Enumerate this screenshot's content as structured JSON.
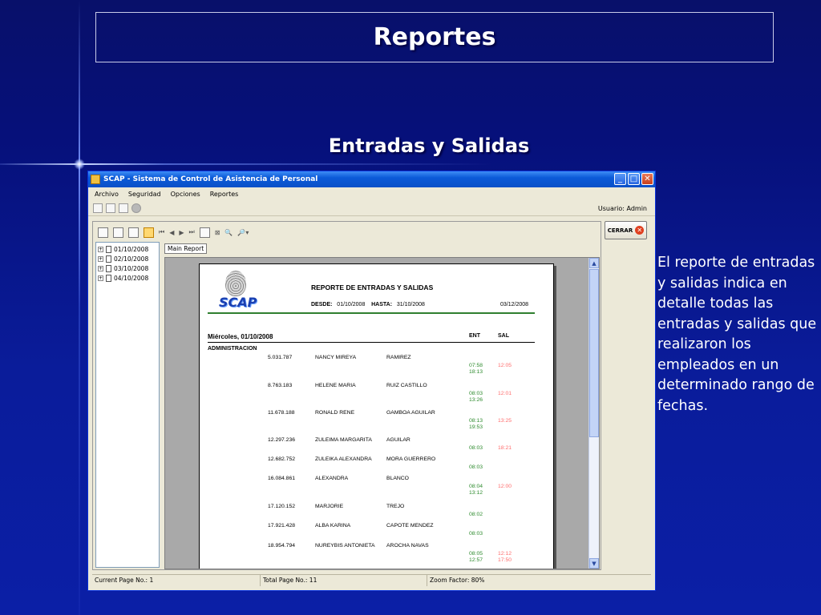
{
  "slide": {
    "title": "Reportes",
    "subtitle": "Entradas y Salidas",
    "description": "El reporte de entradas y salidas indica en detalle todas las entradas y salidas que realizaron los empleados en un determinado rango de fechas."
  },
  "window": {
    "title": "SCAP - Sistema de Control de Asistencia de Personal",
    "menu": [
      "Archivo",
      "Seguridad",
      "Opciones",
      "Reportes"
    ],
    "user_label": "Usuario: Admin",
    "close_button": "CERRAR",
    "tab_label": "Main Report",
    "tree": [
      "01/10/2008",
      "02/10/2008",
      "03/10/2008",
      "04/10/2008"
    ],
    "status": {
      "current_page": "Current Page No.: 1",
      "total_page": "Total Page No.: 11",
      "zoom": "Zoom Factor: 80%"
    }
  },
  "report": {
    "logo_text": "SCAP",
    "title": "REPORTE DE ENTRADAS Y SALIDAS",
    "desde_label": "DESDE:",
    "desde_value": "01/10/2008",
    "hasta_label": "HASTA:",
    "hasta_value": "31/10/2008",
    "print_date": "03/12/2008",
    "day_header": "Miércoles, 01/10/2008",
    "ent_header": "ENT",
    "sal_header": "SAL",
    "department": "ADMINISTRACION",
    "rows": [
      {
        "ci": "5.031.787",
        "nombre": "NANCY MIREYA",
        "apellido": "RAMIREZ",
        "ent": "07:58\n18:13",
        "sal": "12:05"
      },
      {
        "ci": "8.763.183",
        "nombre": "HELENE MARIA",
        "apellido": "RUIZ CASTILLO",
        "ent": "08:03\n13:26",
        "sal": "12:01"
      },
      {
        "ci": "11.678.188",
        "nombre": "RONALD RENE",
        "apellido": "GAMBOA AGUILAR",
        "ent": "08:13\n19:53",
        "sal": "13:25"
      },
      {
        "ci": "12.297.236",
        "nombre": "ZULEIMA MARGARITA",
        "apellido": "AGUILAR",
        "ent": "08:03",
        "sal": "18:21"
      },
      {
        "ci": "12.682.752",
        "nombre": "ZULEIKA ALEXANDRA",
        "apellido": "MORA GUERRERO",
        "ent": "08:03",
        "sal": ""
      },
      {
        "ci": "16.084.861",
        "nombre": "ALEXANDRA",
        "apellido": "BLANCO",
        "ent": "08:04\n13:12",
        "sal": "12:00"
      },
      {
        "ci": "17.120.152",
        "nombre": "MARJORIE",
        "apellido": "TREJO",
        "ent": "08:02",
        "sal": ""
      },
      {
        "ci": "17.921.428",
        "nombre": "ALBA KARINA",
        "apellido": "CAPOTE MENDEZ",
        "ent": "08:03",
        "sal": ""
      },
      {
        "ci": "18.954.794",
        "nombre": "NUREYBIS ANTONIETA",
        "apellido": "AROCHA NAVAS",
        "ent": "08:05\n12:57",
        "sal": "12:12\n17:50"
      }
    ]
  },
  "colors": {
    "slide_bg": "#0a1c9a",
    "ent_green": "#2e8b2e",
    "sal_red": "#ff6d6d"
  }
}
